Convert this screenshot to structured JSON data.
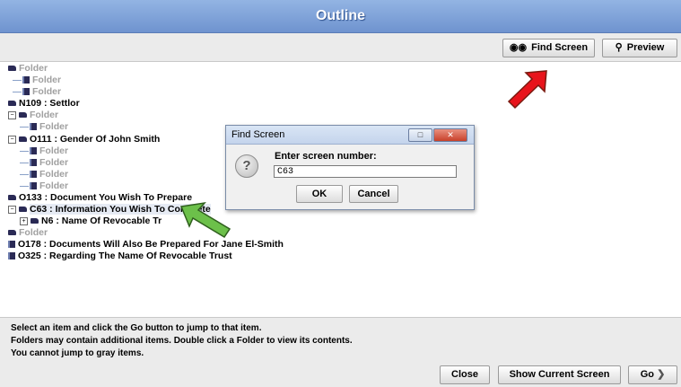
{
  "window": {
    "title": "Outline"
  },
  "toolbar": {
    "find_screen_label": "Find Screen",
    "preview_label": "Preview"
  },
  "tree": {
    "items": [
      {
        "label": "Folder",
        "gray": true
      },
      {
        "label": "Folder",
        "gray": true
      },
      {
        "label": "Folder",
        "gray": true
      },
      {
        "label": "N109 : Settlor",
        "gray": false
      },
      {
        "label": "Folder",
        "gray": true
      },
      {
        "label": "Folder",
        "gray": true
      },
      {
        "label": "O111 : Gender Of John Smith",
        "gray": false
      },
      {
        "label": "Folder",
        "gray": true
      },
      {
        "label": "Folder",
        "gray": true
      },
      {
        "label": "Folder",
        "gray": true
      },
      {
        "label": "Folder",
        "gray": true
      },
      {
        "label": "O133 : Document You Wish To Prepare",
        "gray": false
      },
      {
        "label": "C63 : Information You Wish To Complete",
        "gray": false
      },
      {
        "label": "N6 : Name Of Revocable Tr",
        "gray": false
      },
      {
        "label": "Folder",
        "gray": true
      },
      {
        "label": "O178 : Documents Will Also Be Prepared For Jane El-Smith",
        "gray": false
      },
      {
        "label": "O325 : Regarding The Name Of Revocable Trust",
        "gray": false
      }
    ]
  },
  "help": {
    "line1": "Select an item and click the Go button to jump to that item.",
    "line2": "Folders may contain additional items. Double click a Folder to view its contents.",
    "line3": "You cannot jump to gray items."
  },
  "footer": {
    "close_label": "Close",
    "show_current_label": "Show Current Screen",
    "go_label": "Go"
  },
  "dialog": {
    "title": "Find Screen",
    "prompt": "Enter screen number:",
    "input_value": "C63",
    "ok_label": "OK",
    "cancel_label": "Cancel"
  },
  "colors": {
    "titlebar": "#7a9cd6",
    "red_arrow": "#e8141b",
    "green_arrow": "#6cc04a"
  }
}
